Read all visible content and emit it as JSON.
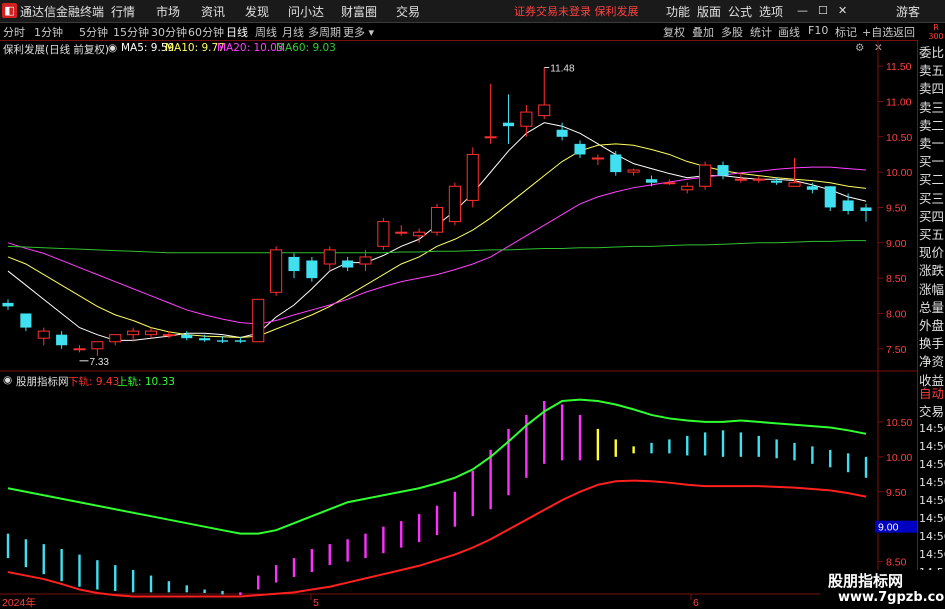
{
  "titlebar": {
    "app_name": "通达信金融终端",
    "menus": [
      "行情",
      "市场",
      "资讯",
      "发现",
      "问小达",
      "财富圈",
      "交易"
    ],
    "alert": "证券交易未登录   保利发展",
    "right_menus": [
      "功能",
      "版面",
      "公式",
      "选项"
    ],
    "guest": "游客",
    "logo_glyph": "◧"
  },
  "toolbar": {
    "periods": [
      "分时",
      "1分钟",
      "5分钟",
      "15分钟",
      "30分钟",
      "60分钟",
      "日线",
      "周线",
      "月线",
      "多周期",
      "更多"
    ],
    "active_period": "日线",
    "right_tools": [
      "复权",
      "叠加",
      "多股",
      "统计",
      "画线",
      "F10",
      "标记",
      "+自选",
      "返回"
    ],
    "scroll_label": "R\n300"
  },
  "main_legend": {
    "stock": "保利发展(日线 前复权)",
    "ma5": "MA5: 9.59",
    "ma10": "MA10: 9.77",
    "ma20": "MA20: 10.03",
    "ma60": "MA60: 9.03"
  },
  "sub_legend": {
    "name": "股朋指标网",
    "lower_label": "下轨: 9.43",
    "upper_label": "上轨: 10.33"
  },
  "sidepanel": {
    "items": [
      "委比",
      "卖五",
      "卖四",
      "卖三",
      "卖二",
      "卖一",
      "买一",
      "买二",
      "买三",
      "买四",
      "买五",
      "现价",
      "涨跌",
      "涨幅",
      "总量",
      "外盘",
      "换手",
      "净资",
      "收益"
    ],
    "sub_items": [
      "自动",
      "交易"
    ],
    "times": [
      "14:56",
      "14:56",
      "14:56",
      "14:56",
      "14:56",
      "14:56",
      "14:56",
      "14:56",
      "14:56"
    ]
  },
  "x_axis": {
    "labels": [
      "2024年",
      "5",
      "6"
    ]
  },
  "main_axis": {
    "ticks": [
      "11.50",
      "11.00",
      "10.50",
      "10.00",
      "9.50",
      "9.00",
      "8.50",
      "8.00",
      "7.50"
    ]
  },
  "sub_axis": {
    "ticks": [
      "10.50",
      "10.00",
      "9.50",
      "9.00",
      "8.50",
      "8.00"
    ],
    "cursor": "9.00"
  },
  "annotations": {
    "high": "11.48",
    "low": "7.33"
  },
  "watermark": {
    "line1": "股朋指标网",
    "line2": "www.7gpzb.com"
  },
  "colors": {
    "up": "#ff3030",
    "down": "#40e0f0",
    "ma5": "#ffffff",
    "ma10": "#ffff60",
    "ma20": "#ff40ff",
    "ma60": "#30c030",
    "upper_band": "#30ff30",
    "lower_band": "#ff2020",
    "magenta_bar": "#ff30ff",
    "yellow_bar": "#ffff30"
  },
  "chart_data": {
    "type": "candlestick",
    "ylim": [
      7.2,
      11.7
    ],
    "candles": [
      [
        8.15,
        8.2,
        8.05,
        8.1
      ],
      [
        8.0,
        8.0,
        7.75,
        7.8
      ],
      [
        7.65,
        7.8,
        7.55,
        7.75
      ],
      [
        7.7,
        7.75,
        7.5,
        7.55
      ],
      [
        7.5,
        7.55,
        7.45,
        7.5
      ],
      [
        7.5,
        7.6,
        7.4,
        7.6
      ],
      [
        7.6,
        7.7,
        7.55,
        7.7
      ],
      [
        7.7,
        7.8,
        7.6,
        7.75
      ],
      [
        7.7,
        7.8,
        7.65,
        7.75
      ],
      [
        7.7,
        7.75,
        7.65,
        7.7
      ],
      [
        7.7,
        7.75,
        7.62,
        7.65
      ],
      [
        7.65,
        7.7,
        7.6,
        7.62
      ],
      [
        7.62,
        7.68,
        7.58,
        7.6
      ],
      [
        7.62,
        7.67,
        7.58,
        7.6
      ],
      [
        7.6,
        8.2,
        7.6,
        8.2
      ],
      [
        8.3,
        8.95,
        8.25,
        8.9
      ],
      [
        8.8,
        8.85,
        8.5,
        8.6
      ],
      [
        8.75,
        8.8,
        8.45,
        8.5
      ],
      [
        8.7,
        8.95,
        8.6,
        8.9
      ],
      [
        8.75,
        8.8,
        8.6,
        8.65
      ],
      [
        8.7,
        8.9,
        8.6,
        8.8
      ],
      [
        8.95,
        9.35,
        8.9,
        9.3
      ],
      [
        9.15,
        9.25,
        9.1,
        9.15
      ],
      [
        9.1,
        9.2,
        9.0,
        9.15
      ],
      [
        9.15,
        9.55,
        9.1,
        9.5
      ],
      [
        9.3,
        9.85,
        9.25,
        9.8
      ],
      [
        9.6,
        10.35,
        9.5,
        10.25
      ],
      [
        10.5,
        11.25,
        10.4,
        10.5
      ],
      [
        10.7,
        11.1,
        10.4,
        10.65
      ],
      [
        10.65,
        10.95,
        10.5,
        10.85
      ],
      [
        10.8,
        11.48,
        10.75,
        10.95
      ],
      [
        10.6,
        10.7,
        10.45,
        10.5
      ],
      [
        10.4,
        10.45,
        10.2,
        10.25
      ],
      [
        10.2,
        10.25,
        10.1,
        10.2
      ],
      [
        10.25,
        10.3,
        9.95,
        10.0
      ],
      [
        10.0,
        10.05,
        9.95,
        10.03
      ],
      [
        9.9,
        9.95,
        9.8,
        9.85
      ],
      [
        9.85,
        9.9,
        9.82,
        9.85
      ],
      [
        9.75,
        9.85,
        9.7,
        9.8
      ],
      [
        9.8,
        10.15,
        9.75,
        10.1
      ],
      [
        10.1,
        10.15,
        9.9,
        9.95
      ],
      [
        9.9,
        10.0,
        9.85,
        9.9
      ],
      [
        9.9,
        9.95,
        9.85,
        9.9
      ],
      [
        9.88,
        9.92,
        9.82,
        9.85
      ],
      [
        9.8,
        10.2,
        9.8,
        9.85
      ],
      [
        9.8,
        9.85,
        9.7,
        9.75
      ],
      [
        9.8,
        9.8,
        9.45,
        9.5
      ],
      [
        9.6,
        9.7,
        9.4,
        9.45
      ],
      [
        9.5,
        9.55,
        9.3,
        9.45
      ]
    ],
    "ma_series": [
      {
        "name": "MA5",
        "values": [
          8.6,
          8.4,
          8.2,
          8.0,
          7.8,
          7.7,
          7.62,
          7.62,
          7.65,
          7.68,
          7.72,
          7.72,
          7.7,
          7.66,
          7.72,
          7.95,
          8.12,
          8.35,
          8.6,
          8.72,
          8.72,
          8.82,
          8.95,
          9.05,
          9.25,
          9.45,
          9.7,
          10.0,
          10.3,
          10.55,
          10.7,
          10.65,
          10.55,
          10.4,
          10.25,
          10.12,
          10.05,
          9.98,
          9.92,
          9.95,
          9.95,
          9.92,
          9.9,
          9.9,
          9.88,
          9.82,
          9.75,
          9.65,
          9.59
        ]
      },
      {
        "name": "MA10",
        "values": [
          8.8,
          8.7,
          8.55,
          8.4,
          8.25,
          8.1,
          7.98,
          7.9,
          7.8,
          7.74,
          7.7,
          7.68,
          7.67,
          7.66,
          7.68,
          7.78,
          7.88,
          7.98,
          8.1,
          8.25,
          8.4,
          8.55,
          8.7,
          8.8,
          8.95,
          9.05,
          9.18,
          9.35,
          9.55,
          9.75,
          9.95,
          10.15,
          10.3,
          10.38,
          10.4,
          10.38,
          10.32,
          10.25,
          10.15,
          10.08,
          10.02,
          9.98,
          9.95,
          9.92,
          9.9,
          9.88,
          9.85,
          9.8,
          9.77
        ]
      },
      {
        "name": "MA20",
        "values": [
          9.0,
          8.92,
          8.85,
          8.75,
          8.65,
          8.55,
          8.45,
          8.35,
          8.25,
          8.15,
          8.05,
          7.98,
          7.92,
          7.87,
          7.85,
          7.9,
          7.98,
          8.05,
          8.12,
          8.2,
          8.3,
          8.38,
          8.45,
          8.5,
          8.55,
          8.62,
          8.7,
          8.8,
          8.95,
          9.1,
          9.25,
          9.4,
          9.55,
          9.65,
          9.72,
          9.78,
          9.82,
          9.86,
          9.9,
          9.93,
          9.96,
          9.99,
          10.01,
          10.04,
          10.06,
          10.07,
          10.07,
          10.05,
          10.03
        ]
      },
      {
        "name": "MA60",
        "values": [
          8.95,
          8.94,
          8.93,
          8.92,
          8.91,
          8.9,
          8.89,
          8.88,
          8.87,
          8.86,
          8.86,
          8.86,
          8.86,
          8.86,
          8.86,
          8.86,
          8.86,
          8.86,
          8.86,
          8.86,
          8.86,
          8.86,
          8.87,
          8.87,
          8.88,
          8.88,
          8.89,
          8.9,
          8.9,
          8.91,
          8.92,
          8.92,
          8.93,
          8.93,
          8.94,
          8.95,
          8.95,
          8.96,
          8.97,
          8.97,
          8.98,
          8.99,
          9.0,
          9.0,
          9.01,
          9.02,
          9.02,
          9.03,
          9.03
        ]
      }
    ],
    "sub_ylim": [
      7.95,
      10.9
    ],
    "upper_band": [
      9.55,
      9.5,
      9.45,
      9.4,
      9.35,
      9.3,
      9.25,
      9.2,
      9.15,
      9.1,
      9.05,
      9.0,
      8.95,
      8.9,
      8.9,
      8.95,
      9.05,
      9.15,
      9.25,
      9.35,
      9.4,
      9.45,
      9.5,
      9.55,
      9.62,
      9.7,
      9.82,
      10.0,
      10.22,
      10.45,
      10.65,
      10.8,
      10.82,
      10.8,
      10.75,
      10.68,
      10.6,
      10.55,
      10.52,
      10.5,
      10.5,
      10.52,
      10.5,
      10.48,
      10.46,
      10.44,
      10.42,
      10.38,
      10.33
    ],
    "lower_band": [
      8.35,
      8.3,
      8.25,
      8.18,
      8.1,
      8.05,
      8.02,
      8.0,
      8.0,
      8.0,
      8.0,
      8.0,
      8.0,
      8.0,
      8.02,
      8.04,
      8.06,
      8.1,
      8.14,
      8.2,
      8.26,
      8.32,
      8.38,
      8.44,
      8.52,
      8.6,
      8.7,
      8.82,
      8.96,
      9.1,
      9.24,
      9.38,
      9.5,
      9.6,
      9.65,
      9.66,
      9.65,
      9.63,
      9.6,
      9.58,
      9.58,
      9.58,
      9.58,
      9.57,
      9.56,
      9.54,
      9.52,
      9.48,
      9.43
    ],
    "bars": [
      {
        "top": 8.9,
        "bottom": 8.55,
        "color": "down"
      },
      {
        "top": 8.82,
        "bottom": 8.42,
        "color": "down"
      },
      {
        "top": 8.75,
        "bottom": 8.32,
        "color": "down"
      },
      {
        "top": 8.68,
        "bottom": 8.22,
        "color": "down"
      },
      {
        "top": 8.6,
        "bottom": 8.14,
        "color": "down"
      },
      {
        "top": 8.52,
        "bottom": 8.1,
        "color": "down"
      },
      {
        "top": 8.45,
        "bottom": 8.08,
        "color": "down"
      },
      {
        "top": 8.38,
        "bottom": 8.06,
        "color": "down"
      },
      {
        "top": 8.3,
        "bottom": 8.06,
        "color": "down"
      },
      {
        "top": 8.22,
        "bottom": 8.06,
        "color": "down"
      },
      {
        "top": 8.16,
        "bottom": 8.06,
        "color": "down"
      },
      {
        "top": 8.1,
        "bottom": 8.05,
        "color": "down"
      },
      {
        "top": 8.08,
        "bottom": 8.03,
        "color": "down"
      },
      {
        "top": 8.06,
        "bottom": 8.02,
        "color": "magenta"
      },
      {
        "top": 8.3,
        "bottom": 8.1,
        "color": "magenta"
      },
      {
        "top": 8.45,
        "bottom": 8.2,
        "color": "magenta"
      },
      {
        "top": 8.55,
        "bottom": 8.28,
        "color": "magenta"
      },
      {
        "top": 8.68,
        "bottom": 8.35,
        "color": "magenta"
      },
      {
        "top": 8.75,
        "bottom": 8.45,
        "color": "magenta"
      },
      {
        "top": 8.82,
        "bottom": 8.5,
        "color": "magenta"
      },
      {
        "top": 8.9,
        "bottom": 8.55,
        "color": "magenta"
      },
      {
        "top": 9.0,
        "bottom": 8.62,
        "color": "magenta"
      },
      {
        "top": 9.08,
        "bottom": 8.7,
        "color": "magenta"
      },
      {
        "top": 9.18,
        "bottom": 8.78,
        "color": "magenta"
      },
      {
        "top": 9.3,
        "bottom": 8.88,
        "color": "magenta"
      },
      {
        "top": 9.5,
        "bottom": 9.0,
        "color": "magenta"
      },
      {
        "top": 9.8,
        "bottom": 9.15,
        "color": "magenta"
      },
      {
        "top": 10.1,
        "bottom": 9.25,
        "color": "magenta"
      },
      {
        "top": 10.4,
        "bottom": 9.45,
        "color": "magenta"
      },
      {
        "top": 10.6,
        "bottom": 9.7,
        "color": "magenta"
      },
      {
        "top": 10.8,
        "bottom": 9.9,
        "color": "magenta"
      },
      {
        "top": 10.75,
        "bottom": 9.95,
        "color": "magenta"
      },
      {
        "top": 10.6,
        "bottom": 9.95,
        "color": "magenta"
      },
      {
        "top": 10.4,
        "bottom": 9.95,
        "color": "yellow"
      },
      {
        "top": 10.25,
        "bottom": 10.0,
        "color": "yellow"
      },
      {
        "top": 10.15,
        "bottom": 10.05,
        "color": "yellow"
      },
      {
        "top": 10.2,
        "bottom": 10.05,
        "color": "down"
      },
      {
        "top": 10.25,
        "bottom": 10.05,
        "color": "down"
      },
      {
        "top": 10.3,
        "bottom": 10.02,
        "color": "down"
      },
      {
        "top": 10.35,
        "bottom": 10.02,
        "color": "down"
      },
      {
        "top": 10.38,
        "bottom": 10.0,
        "color": "down"
      },
      {
        "top": 10.35,
        "bottom": 10.0,
        "color": "down"
      },
      {
        "top": 10.3,
        "bottom": 10.0,
        "color": "down"
      },
      {
        "top": 10.25,
        "bottom": 9.98,
        "color": "down"
      },
      {
        "top": 10.2,
        "bottom": 9.95,
        "color": "down"
      },
      {
        "top": 10.15,
        "bottom": 9.9,
        "color": "down"
      },
      {
        "top": 10.1,
        "bottom": 9.85,
        "color": "down"
      },
      {
        "top": 10.05,
        "bottom": 9.78,
        "color": "down"
      },
      {
        "top": 10.0,
        "bottom": 9.7,
        "color": "down"
      }
    ]
  }
}
